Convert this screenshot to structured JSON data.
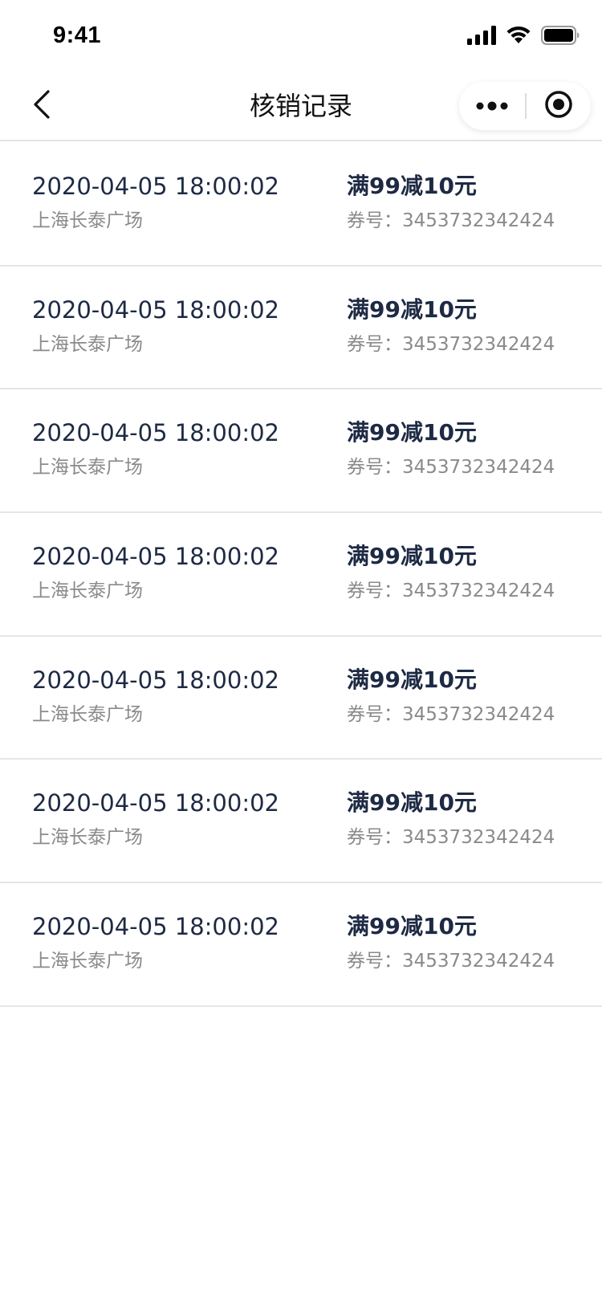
{
  "status_bar": {
    "time": "9:41",
    "icons": [
      "signal-icon",
      "wifi-icon",
      "battery-icon"
    ]
  },
  "nav": {
    "title": "核销记录",
    "back_icon": "chevron-left-icon",
    "more_icon": "more-dots-icon",
    "close_icon": "miniprogram-close-icon"
  },
  "records": [
    {
      "time": "2020-04-05  18:00:02",
      "store": "上海长泰广场",
      "coupon": "满99减10元",
      "code_label": "券号：",
      "code": "3453732342424"
    },
    {
      "time": "2020-04-05  18:00:02",
      "store": "上海长泰广场",
      "coupon": "满99减10元",
      "code_label": "券号：",
      "code": "3453732342424"
    },
    {
      "time": "2020-04-05  18:00:02",
      "store": "上海长泰广场",
      "coupon": "满99减10元",
      "code_label": "券号：",
      "code": "3453732342424"
    },
    {
      "time": "2020-04-05  18:00:02",
      "store": "上海长泰广场",
      "coupon": "满99减10元",
      "code_label": "券号：",
      "code": "3453732342424"
    },
    {
      "time": "2020-04-05  18:00:02",
      "store": "上海长泰广场",
      "coupon": "满99减10元",
      "code_label": "券号：",
      "code": "3453732342424"
    },
    {
      "time": "2020-04-05  18:00:02",
      "store": "上海长泰广场",
      "coupon": "满99减10元",
      "code_label": "券号：",
      "code": "3453732342424"
    },
    {
      "time": "2020-04-05  18:00:02",
      "store": "上海长泰广场",
      "coupon": "满99减10元",
      "code_label": "券号：",
      "code": "3453732342424"
    }
  ],
  "colors": {
    "primary_text": "#1e2a44",
    "secondary_text": "#8a8a8a",
    "divider": "#e6e6e6"
  }
}
